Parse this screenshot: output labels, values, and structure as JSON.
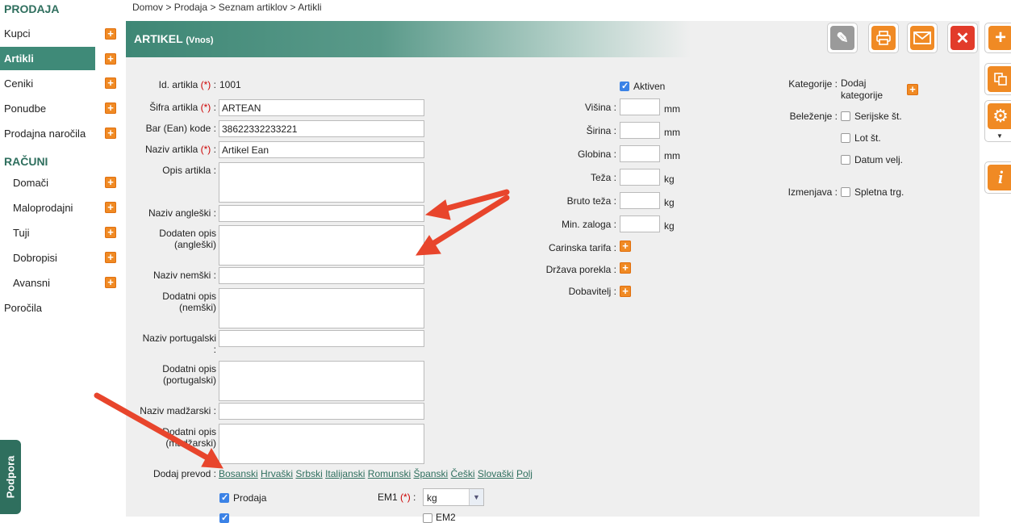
{
  "breadcrumb": {
    "home": "Domov",
    "sep": ">",
    "prodaja": "Prodaja",
    "list": "Seznam artiklov",
    "current": "Artikli"
  },
  "sidebar": {
    "section_prodaja": "PRODAJA",
    "items_prodaja": [
      {
        "label": "Kupci"
      },
      {
        "label": "Artikli"
      },
      {
        "label": "Ceniki"
      },
      {
        "label": "Ponudbe"
      },
      {
        "label": "Prodajna naročila"
      }
    ],
    "section_racuni": "RAČUNI",
    "items_racuni": [
      {
        "label": "Domači"
      },
      {
        "label": "Maloprodajni"
      },
      {
        "label": "Tuji"
      },
      {
        "label": "Dobropisi"
      },
      {
        "label": "Avansni"
      }
    ],
    "porocila": "Poročila",
    "podpora": "Podpora"
  },
  "header": {
    "title": "ARTIKEL",
    "subtitle": "(Vnos)"
  },
  "form": {
    "id_label": "Id. artikla",
    "id_value": "1001",
    "sifra_label": "Šifra artikla",
    "sifra_value": "ARTEAN",
    "ean_label": "Bar (Ean) kode",
    "ean_value": "38622332233221",
    "naziv_label": "Naziv artikla",
    "naziv_value": "Artikel Ean",
    "opis_label": "Opis artikla",
    "naziv_ang_label": "Naziv angleški",
    "opis_ang_label1": "Dodaten opis",
    "opis_ang_label2": "(angleški)",
    "naziv_nem_label": "Naziv nemški",
    "opis_nem_label1": "Dodatni opis",
    "opis_nem_label2": "(nemški)",
    "naziv_por_label": "Naziv portugalski",
    "opis_por_label1": "Dodatni opis",
    "opis_por_label2": "(portugalski)",
    "naziv_mad_label": "Naziv madžarski",
    "opis_mad_label1": "Dodatni opis",
    "opis_mad_label2": "(madžarski)",
    "req_mark": "(*)",
    "colon": ":",
    "dodaj_prevod": "Dodaj prevod :",
    "languages": [
      "Bosanski",
      "Hrvaški",
      "Srbski",
      "Italijanski",
      "Romunski",
      "Španski",
      "Češki",
      "Slovaški",
      "Polj"
    ],
    "prodaja_label": "Prodaja",
    "em1_label": "EM1",
    "em1_value": "kg",
    "em2_label": "EM2"
  },
  "mid": {
    "aktiven": "Aktiven",
    "visina": "Višina :",
    "sirina": "Širina :",
    "globina": "Globina :",
    "teza": "Teža :",
    "bruto": "Bruto teža :",
    "zaloga": "Min. zaloga :",
    "mm": "mm",
    "kg": "kg",
    "carinska": "Carinska tarifa :",
    "drzava": "Država porekla :",
    "dobavitelj": "Dobavitelj :"
  },
  "right": {
    "kategorije_label": "Kategorije :",
    "dodaj_kat1": "Dodaj",
    "dodaj_kat2": "kategorije",
    "belezenje_label": "Beleženje :",
    "serijske": "Serijske št.",
    "lot": "Lot št.",
    "datum": "Datum velj.",
    "izmenjava_label": "Izmenjava :",
    "spletna": "Spletna trg."
  },
  "colors": {
    "accent": "#3f8a78",
    "orange": "#f08a24",
    "red": "#e23b2a",
    "arrow": "#e8452c"
  }
}
